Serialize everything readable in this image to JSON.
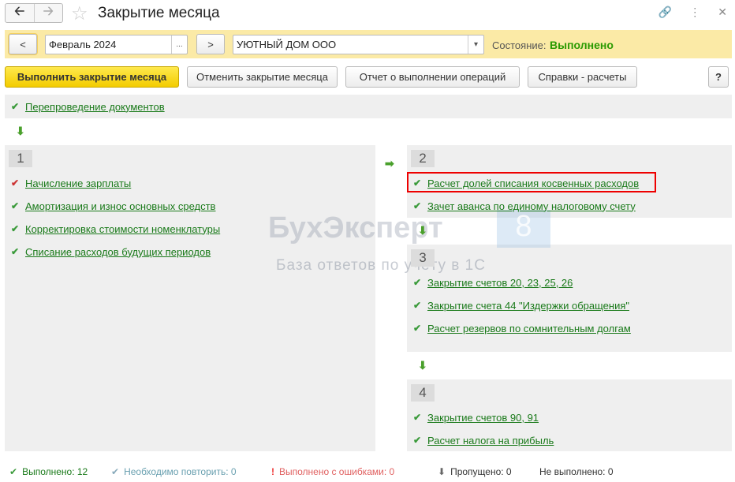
{
  "header": {
    "title": "Закрытие месяца",
    "back_icon": "arrow-left",
    "forward_icon": "arrow-right",
    "favorite_icon": "star"
  },
  "toolbar": {
    "prev_label": "<",
    "next_label": ">",
    "period": "Февраль 2024",
    "period_btn": "...",
    "organization": "УЮТНЫЙ ДОМ ООО",
    "state_label": "Состояние:",
    "state_value": "Выполнено",
    "state_color": "#2a9a00"
  },
  "actions": {
    "execute": "Выполнить закрытие месяца",
    "cancel": "Отменить закрытие месяца",
    "report": "Отчет о выполнении операций",
    "help": "Справки - расчеты",
    "question": "?"
  },
  "pre_step": {
    "label": "Перепроведение документов"
  },
  "groups": [
    {
      "number": "1",
      "items": [
        "Начисление зарплаты",
        "Амортизация и износ основных средств",
        "Корректировка стоимости номенклатуры",
        "Списание расходов будущих периодов"
      ]
    },
    {
      "number": "2",
      "items": [
        "Расчет долей списания косвенных расходов",
        "Зачет аванса по единому налоговому счету"
      ]
    },
    {
      "number": "3",
      "items": [
        "Закрытие счетов 20, 23, 25, 26",
        "Закрытие счета 44 \"Издержки обращения\"",
        "Расчет резервов по сомнительным долгам"
      ]
    },
    {
      "number": "4",
      "items": [
        "Закрытие счетов 90, 91",
        "Расчет налога на прибыль"
      ]
    }
  ],
  "watermark": {
    "brand": "БухЭксперт",
    "version": "8",
    "slogan": "База ответов по учёту в 1С"
  },
  "status_bar": {
    "done": "Выполнено: 12",
    "repeat": "Необходимо повторить: 0",
    "errors": "Выполнено с ошибками: 0",
    "skipped": "Пропущено: 0",
    "not_done": "Не выполнено: 0"
  }
}
